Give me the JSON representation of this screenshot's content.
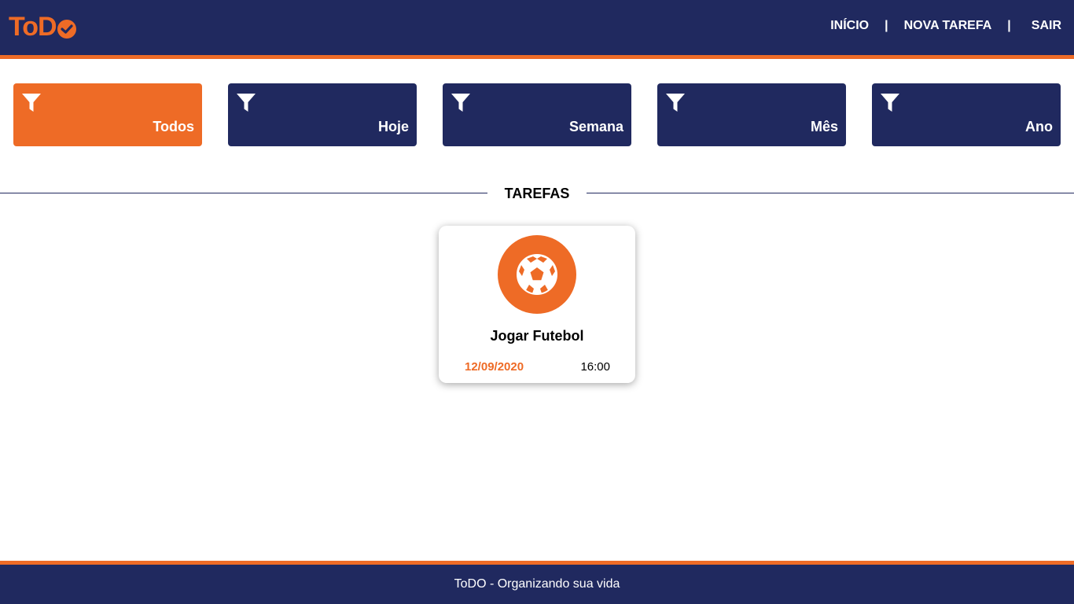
{
  "header": {
    "logo_text": "ToD",
    "nav": {
      "home": "INÍCIO",
      "new_task": "NOVA TAREFA",
      "logout": "SAIR",
      "separator": "|"
    }
  },
  "filters": [
    {
      "label": "Todos",
      "active": true
    },
    {
      "label": "Hoje",
      "active": false
    },
    {
      "label": "Semana",
      "active": false
    },
    {
      "label": "Mês",
      "active": false
    },
    {
      "label": "Ano",
      "active": false
    }
  ],
  "section_title": "TAREFAS",
  "tasks": [
    {
      "icon": "soccer-ball-icon",
      "title": "Jogar Futebol",
      "date": "12/09/2020",
      "time": "16:00"
    }
  ],
  "footer": {
    "text": "ToDO - Organizando sua vida"
  },
  "colors": {
    "primary": "#20295f",
    "accent": "#ee6b26"
  }
}
